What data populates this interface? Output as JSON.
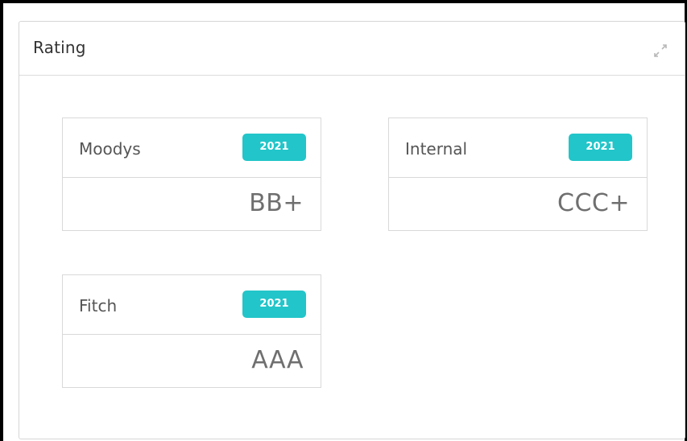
{
  "panel": {
    "title": "Rating",
    "expand_icon": "expand-arrows-icon"
  },
  "ratings": [
    {
      "agency": "Moodys",
      "year": "2021",
      "rating": "BB+"
    },
    {
      "agency": "Internal",
      "year": "2021",
      "rating": "CCC+"
    },
    {
      "agency": "Fitch",
      "year": "2021",
      "rating": "AAA"
    }
  ],
  "colors": {
    "badge": "#22c5c9",
    "border": "#d9d9d9",
    "value_text": "#6f6f6f"
  }
}
